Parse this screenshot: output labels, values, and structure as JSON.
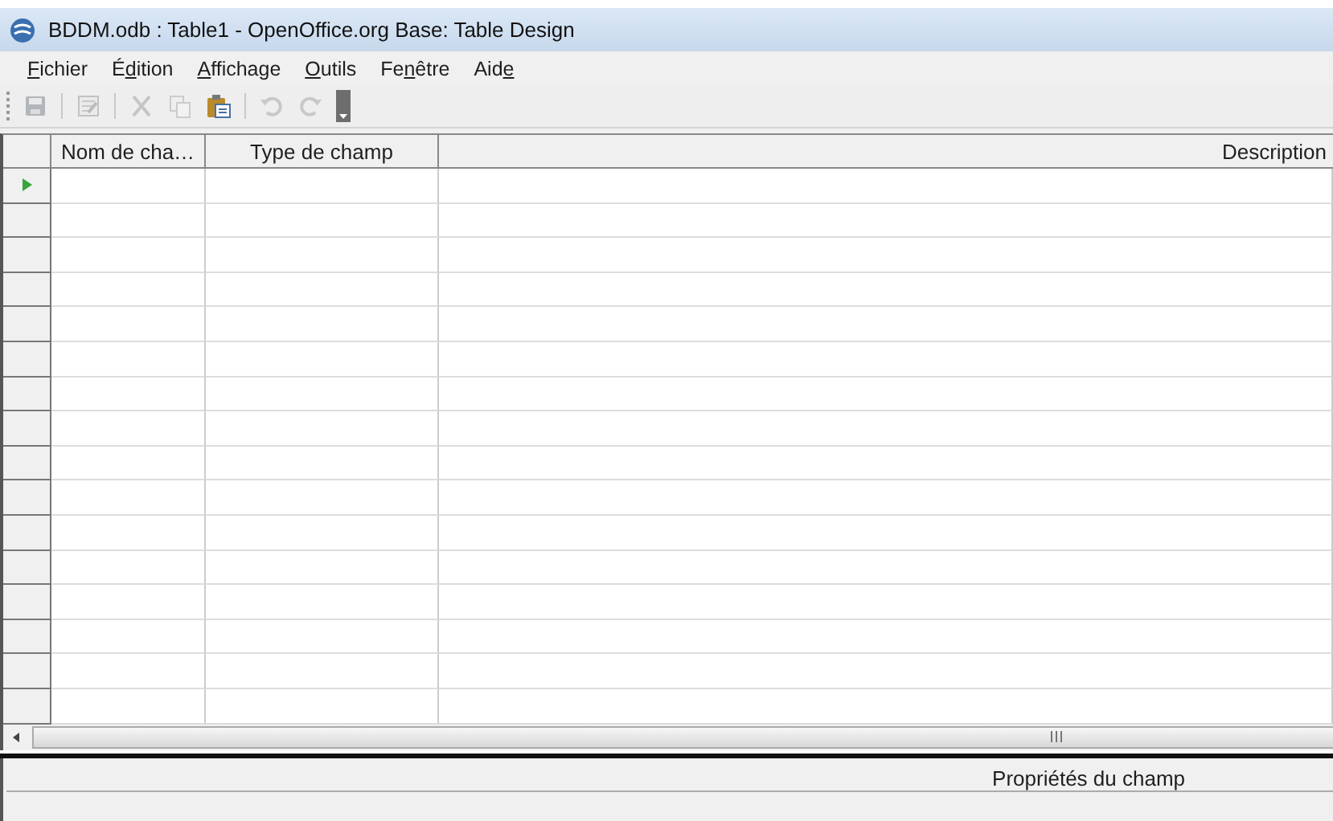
{
  "window": {
    "title": "BDDM.odb : Table1 - OpenOffice.org Base: Table Design"
  },
  "menu": [
    {
      "key": "F",
      "after": "ichier"
    },
    {
      "before": "É",
      "key": "d",
      "after": "ition"
    },
    {
      "key": "A",
      "after": "ffichage"
    },
    {
      "key": "O",
      "after": "utils"
    },
    {
      "before": "Fe",
      "key": "n",
      "after": "être"
    },
    {
      "before": "Aid",
      "key": "e"
    }
  ],
  "toolbar": [
    {
      "kind": "save",
      "disabled": true
    },
    {
      "kind": "sep"
    },
    {
      "kind": "edit",
      "disabled": true
    },
    {
      "kind": "sep"
    },
    {
      "kind": "cut",
      "disabled": true
    },
    {
      "kind": "copy",
      "disabled": true
    },
    {
      "kind": "paste",
      "disabled": false
    },
    {
      "kind": "sep"
    },
    {
      "kind": "undo",
      "disabled": true
    },
    {
      "kind": "redo",
      "disabled": true
    },
    {
      "kind": "more",
      "disabled": false
    }
  ],
  "table": {
    "columns": [
      "Nom de cha…",
      "Type de champ",
      "Description"
    ],
    "rows": [
      {
        "current": true
      },
      {
        "current": false
      },
      {
        "current": false
      },
      {
        "current": false
      },
      {
        "current": false
      },
      {
        "current": false
      },
      {
        "current": false
      },
      {
        "current": false
      },
      {
        "current": false
      },
      {
        "current": false
      },
      {
        "current": false
      },
      {
        "current": false
      },
      {
        "current": false
      },
      {
        "current": false
      },
      {
        "current": false
      },
      {
        "current": false
      }
    ]
  },
  "properties": {
    "title": "Propriétés du champ"
  }
}
